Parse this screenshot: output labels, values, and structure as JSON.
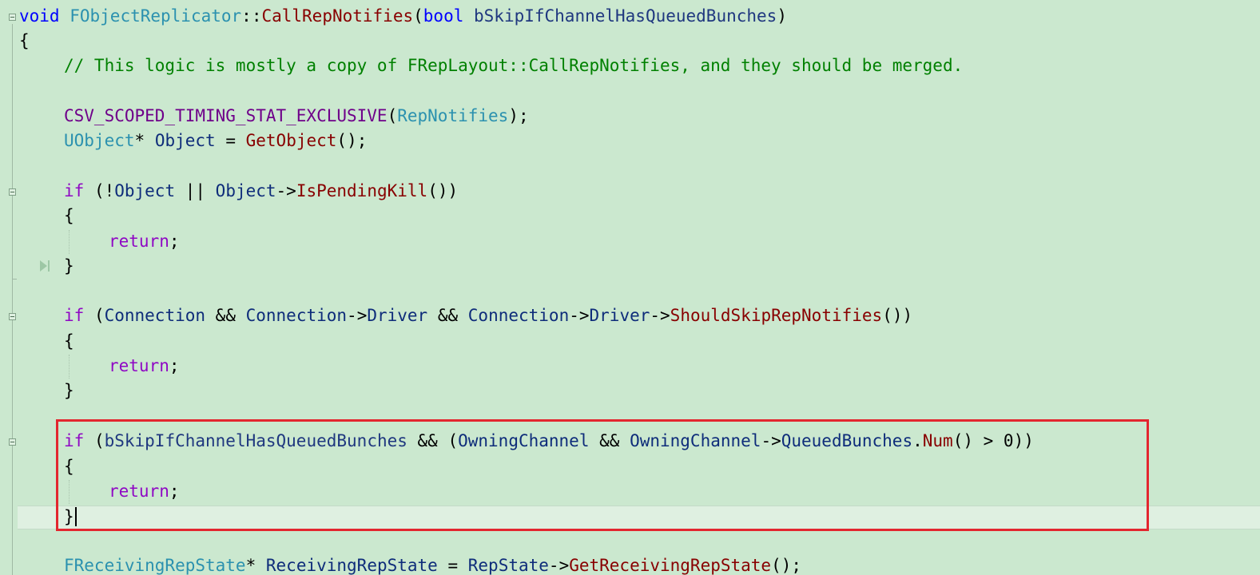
{
  "editor": {
    "line_1": {
      "ret_type": "void",
      "class_name": "FObjectReplicator",
      "scope": "::",
      "func_name": "CallRepNotifies",
      "open": "(",
      "param_type": "bool",
      "param_name": "bSkipIfChannelHasQueuedBunches",
      "close": ")"
    },
    "line_2": {
      "brace": "{"
    },
    "line_3": {
      "comment": "// This logic is mostly a copy of FRepLayout::CallRepNotifies, and they should be merged."
    },
    "line_5": {
      "macro": "CSV_SCOPED_TIMING_STAT_EXCLUSIVE",
      "open": "(",
      "arg": "RepNotifies",
      "close": ");"
    },
    "line_6": {
      "type": "UObject",
      "ptr": "*",
      "var": "Object",
      "assign": " = ",
      "call": "GetObject",
      "tail": "();"
    },
    "line_8": {
      "kw": "if",
      "p1": " (!",
      "v1": "Object",
      "op": " || ",
      "v2": "Object",
      "arrow": "->",
      "call": "IsPendingKill",
      "tail": "())"
    },
    "line_9": {
      "brace": "{"
    },
    "line_10": {
      "kw": "return",
      "tail": ";"
    },
    "line_11": {
      "brace": "}"
    },
    "line_13": {
      "kw": "if",
      "p1": " (",
      "v1": "Connection",
      "and1": " && ",
      "v2": "Connection",
      "arrow1": "->",
      "m1": "Driver",
      "and2": " && ",
      "v3": "Connection",
      "arrow2": "->",
      "m2": "Driver",
      "arrow3": "->",
      "call": "ShouldSkipRepNotifies",
      "tail": "())"
    },
    "line_14": {
      "brace": "{"
    },
    "line_15": {
      "kw": "return",
      "tail": ";"
    },
    "line_16": {
      "brace": "}"
    },
    "line_18": {
      "kw": "if",
      "p1": " (",
      "v1": "bSkipIfChannelHasQueuedBunches",
      "and1": " && (",
      "v2": "OwningChannel",
      "and2": " && ",
      "v3": "OwningChannel",
      "arrow": "->",
      "m1": "QueuedBunches",
      "dot": ".",
      "call": "Num",
      "cmp": "() > ",
      "num": "0",
      "tail": "))"
    },
    "line_19": {
      "brace": "{"
    },
    "line_20": {
      "kw": "return",
      "tail": ";"
    },
    "line_21": {
      "brace": "}"
    },
    "line_23": {
      "type": "FReceivingRepState",
      "ptr": "*",
      "var": "ReceivingRepState",
      "assign": " = ",
      "obj": "RepState",
      "arrow": "->",
      "call": "GetReceivingRepState",
      "tail": "();"
    }
  },
  "colors": {
    "background": "#cbe8cf",
    "keyword": "#8f08c4",
    "type_keyword": "#0000ff",
    "class_type": "#2b91af",
    "function": "#880000",
    "macro": "#6f008a",
    "parameter": "#1f377f",
    "member": "#0e2c7a",
    "comment": "#008000",
    "highlight_box": "#e3262f"
  }
}
